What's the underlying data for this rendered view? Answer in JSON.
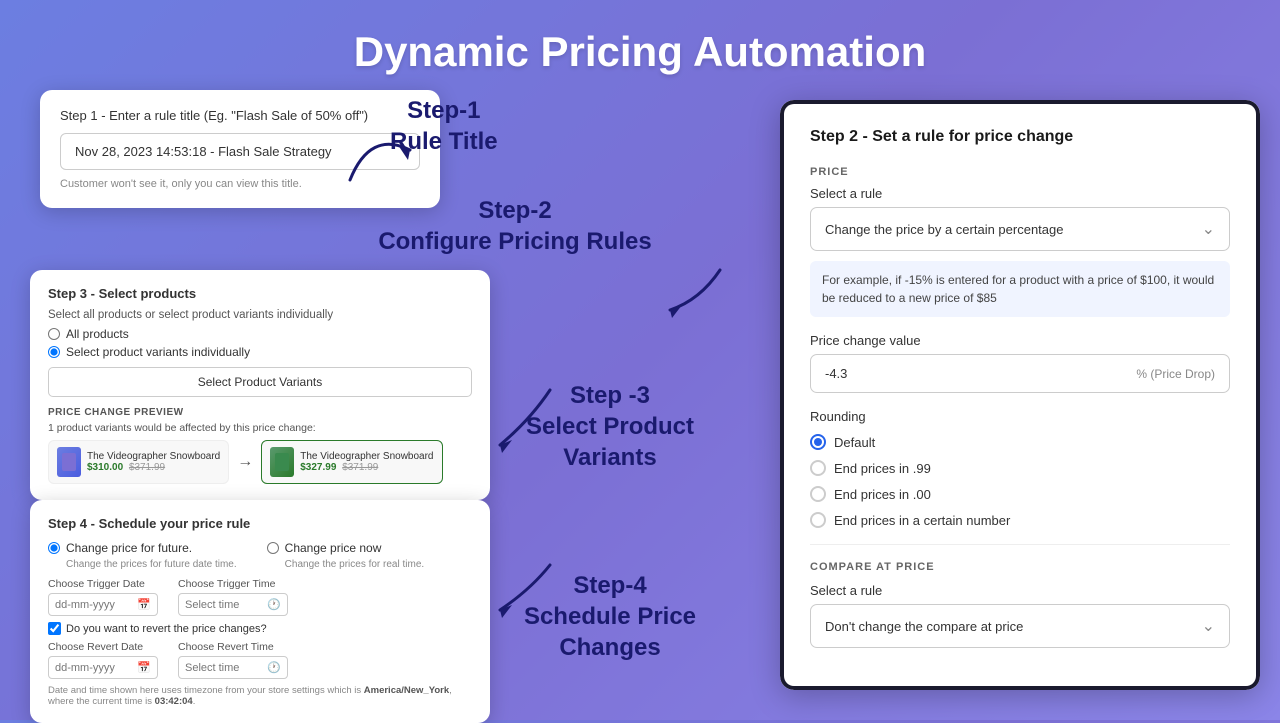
{
  "page": {
    "title": "Dynamic Pricing Automation",
    "background": "#7b6fd4"
  },
  "step1": {
    "card_label": "Step 1 - Enter a rule title (Eg. \"Flash Sale of 50% off\")",
    "input_value": "Nov 28, 2023 14:53:18 - Flash Sale Strategy",
    "help_text": "Customer won't see it, only you can view this title.",
    "step_title": "Step-1",
    "step_subtitle": "Rule Title"
  },
  "step2": {
    "step_title": "Step-2",
    "step_subtitle": "Configure Pricing Rules"
  },
  "step3": {
    "card_title": "Step 3 - Select products",
    "sub_label": "Select all products or select product variants individually",
    "option1": "All products",
    "option2": "Select product variants individually",
    "btn_label": "Select Product Variants",
    "preview_label": "PRICE CHANGE PREVIEW",
    "affected_text": "1 product variants would be affected by this price change:",
    "product1_name": "The Videographer Snowboard",
    "product1_price_new": "$310.00",
    "product1_price_old": "$371.99",
    "product2_name": "The Videographer Snowboard",
    "product2_price_new": "$327.99",
    "product2_price_old": "$371.99",
    "step_title": "Step -3",
    "step_subtitle": "Select Product\nVariants"
  },
  "step4": {
    "card_title": "Step 4 - Schedule your price rule",
    "option1_label": "Change price for future.",
    "option1_sub": "Change the prices for future date time.",
    "option2_label": "Change price now",
    "option2_sub": "Change the prices for real time.",
    "trigger_date_label": "Choose Trigger Date",
    "trigger_date_placeholder": "dd-mm-yyyy",
    "trigger_time_label": "Choose Trigger Time",
    "trigger_time_placeholder": "Select time",
    "revert_checkbox": "Do you want to revert the price changes?",
    "revert_date_label": "Choose Revert Date",
    "revert_date_placeholder": "dd-mm-yyyy",
    "revert_time_label": "Choose Revert Time",
    "revert_time_placeholder": "Select time",
    "footer_text": "Date and time shown here uses timezone from your store settings which is America/New_York, where the current time is 03:42:04.",
    "step_title": "Step-4",
    "step_subtitle": "Schedule Price\nChanges"
  },
  "right_panel": {
    "title": "Step 2 - Set a rule for price change",
    "price_section_label": "PRICE",
    "select_rule_label": "Select a rule",
    "selected_rule": "Change the price by a certain percentage",
    "info_text": "For example, if -15% is entered for a product with a price of $100, it would be reduced to a new price of $85",
    "price_change_label": "Price change value",
    "price_change_value": "-4.3",
    "price_change_suffix": "% (Price Drop)",
    "rounding_label": "Rounding",
    "rounding_options": [
      {
        "label": "Default",
        "selected": true
      },
      {
        "label": "End prices in .99",
        "selected": false
      },
      {
        "label": "End prices in .00",
        "selected": false
      },
      {
        "label": "End prices in a certain number",
        "selected": false
      }
    ],
    "compare_section_label": "COMPARE AT PRICE",
    "compare_rule_label": "Select a rule",
    "compare_selected_rule": "Don't change the compare at price"
  }
}
